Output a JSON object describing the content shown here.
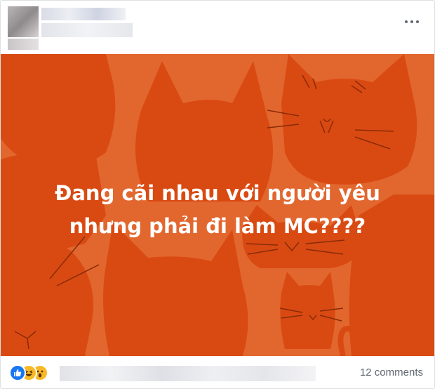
{
  "post": {
    "caption_line1": "Đang cãi nhau với người yêu",
    "caption_line2": "nhưng phải đi làm MC????",
    "image_background_color": "#e2672e",
    "cat_color": "#d94a12",
    "stroke_color": "#8a2a08"
  },
  "header": {
    "author_name_redacted": true,
    "more_icon": "more-horizontal-icon"
  },
  "reactions": {
    "icons": [
      "like-icon",
      "haha-icon",
      "wow-icon"
    ],
    "names_redacted": true,
    "comments_label": "12 comments"
  }
}
